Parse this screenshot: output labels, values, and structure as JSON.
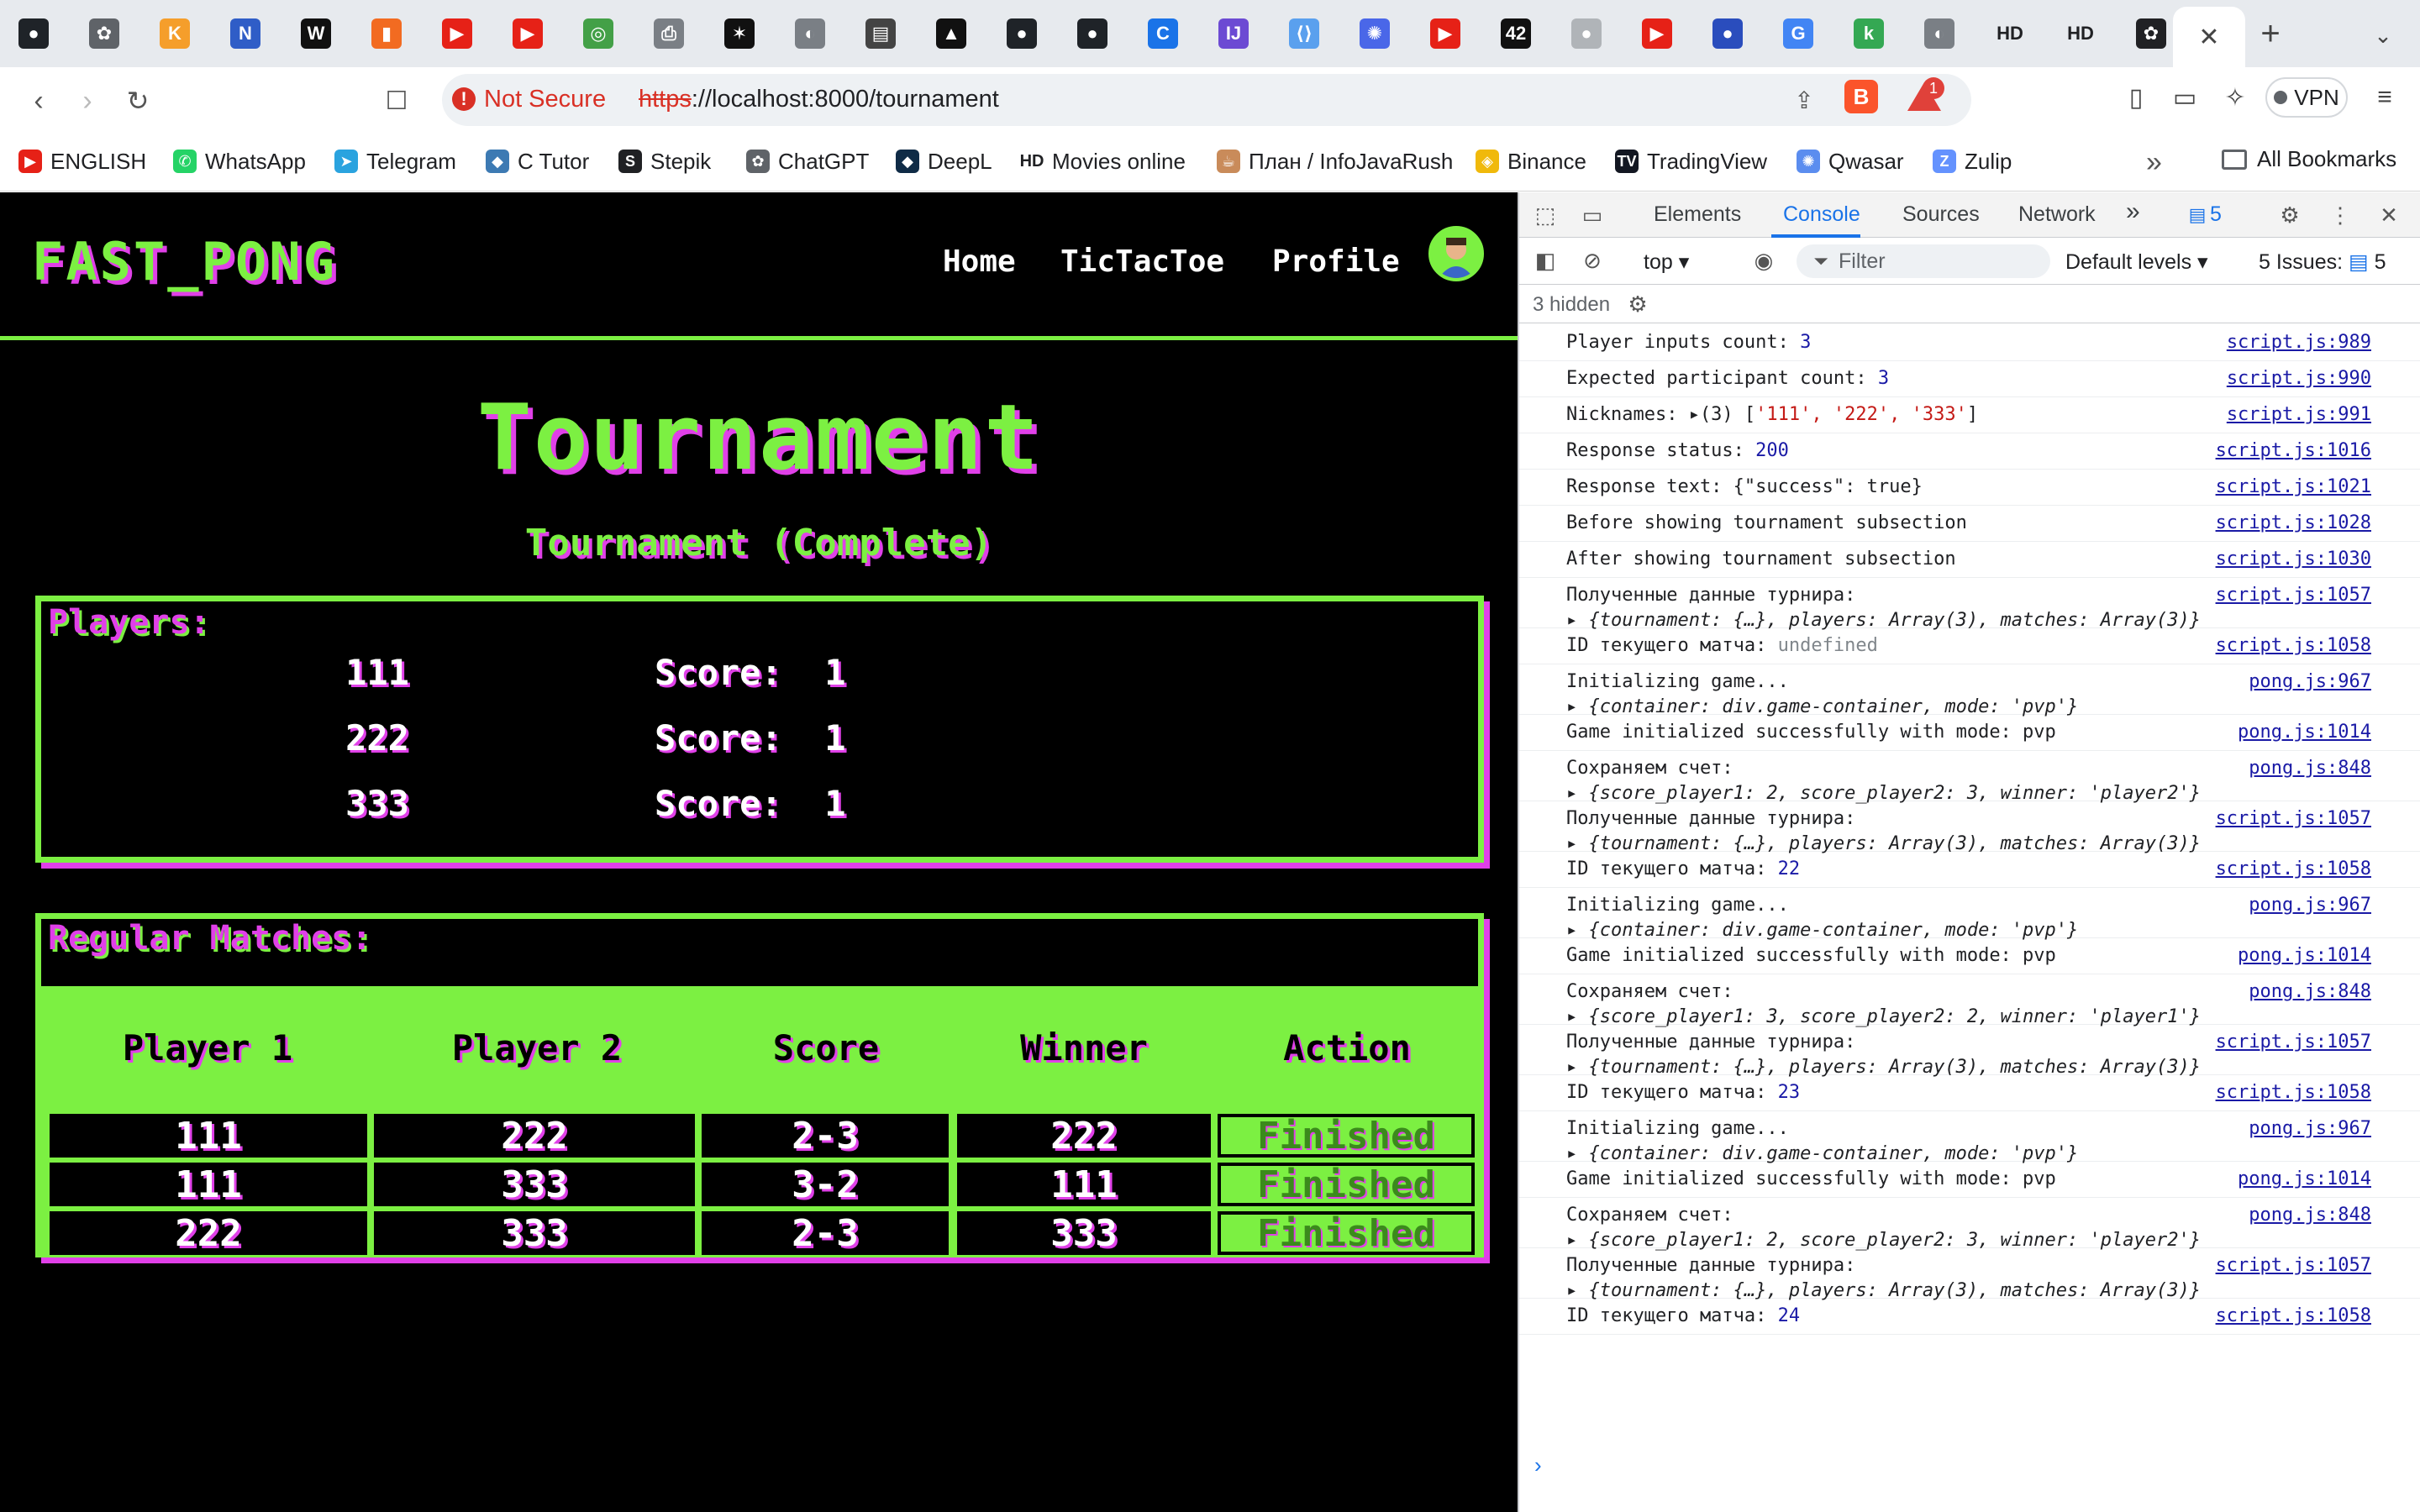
{
  "browser": {
    "tab_icons": [
      {
        "name": "github-icon",
        "glyph": "●",
        "bg": "#1f2328"
      },
      {
        "name": "openai-icon",
        "glyph": "✿",
        "bg": "#5f6368"
      },
      {
        "name": "k-icon",
        "glyph": "K",
        "bg": "#f59e2b"
      },
      {
        "name": "notion-icon",
        "glyph": "N",
        "bg": "#2f5dc7"
      },
      {
        "name": "www-icon",
        "glyph": "W",
        "bg": "#111"
      },
      {
        "name": "chart-icon",
        "glyph": "▮",
        "bg": "#f26b21"
      },
      {
        "name": "youtube-icon",
        "glyph": "▶",
        "bg": "#e62117"
      },
      {
        "name": "youtube-icon",
        "glyph": "▶",
        "bg": "#e62117"
      },
      {
        "name": "globe-green-icon",
        "glyph": "◎",
        "bg": "#43a047"
      },
      {
        "name": "printer-icon",
        "glyph": "⎙",
        "bg": "#7a7f85"
      },
      {
        "name": "app-icon",
        "glyph": "✶",
        "bg": "#111"
      },
      {
        "name": "globe-icon",
        "glyph": "◐",
        "bg": "#7a7f85"
      },
      {
        "name": "book-icon",
        "glyph": "▤",
        "bg": "#444"
      },
      {
        "name": "triangle-icon",
        "glyph": "▲",
        "bg": "#111"
      },
      {
        "name": "github-icon",
        "glyph": "●",
        "bg": "#1f2328"
      },
      {
        "name": "github-icon",
        "glyph": "●",
        "bg": "#1f2328"
      },
      {
        "name": "c-icon",
        "glyph": "C",
        "bg": "#1a73e8"
      },
      {
        "name": "jetbrains-icon",
        "glyph": "IJ",
        "bg": "#6c4ad3"
      },
      {
        "name": "code-icon",
        "glyph": "⟨⟩",
        "bg": "#5aa0ee"
      },
      {
        "name": "asterisk-icon",
        "glyph": "✺",
        "bg": "#4a67e8"
      },
      {
        "name": "youtube-icon",
        "glyph": "▶",
        "bg": "#e62117"
      },
      {
        "name": "42-icon",
        "glyph": "42",
        "bg": "#111"
      },
      {
        "name": "github-icon",
        "glyph": "●",
        "bg": "#b0b4b8"
      },
      {
        "name": "youtube-icon",
        "glyph": "▶",
        "bg": "#e62117"
      },
      {
        "name": "circle-blue-icon",
        "glyph": "●",
        "bg": "#2a4dbd"
      },
      {
        "name": "google-icon",
        "glyph": "G",
        "bg": "#4285f4"
      },
      {
        "name": "k-green-icon",
        "glyph": "k",
        "bg": "#34a853"
      },
      {
        "name": "globe-icon",
        "glyph": "◐",
        "bg": "#7a7f85"
      },
      {
        "name": "hd-icon",
        "glyph": "HD",
        "bg": "#e7eaee"
      },
      {
        "name": "hd-icon",
        "glyph": "HD",
        "bg": "#e7eaee"
      },
      {
        "name": "openai-icon",
        "glyph": "✿",
        "bg": "#202124"
      }
    ],
    "new_tab_glyph": "+",
    "close_tab_glyph": "✕",
    "tab_menu_glyph": "⌄",
    "not_secure": "Not Secure",
    "url_scheme": "https",
    "url_rest": "://localhost:8000/tournament",
    "vpn_label": "VPN",
    "alert_badge": "1",
    "bookmarks": [
      {
        "label": "ENGLISH",
        "icon": "youtube-icon",
        "glyph": "▶",
        "bg": "#e62117"
      },
      {
        "label": "WhatsApp",
        "icon": "whatsapp-icon",
        "glyph": "✆",
        "bg": "#25d366"
      },
      {
        "label": "Telegram",
        "icon": "telegram-icon",
        "glyph": "➤",
        "bg": "#2aa3df"
      },
      {
        "label": "C Tutor",
        "icon": "python-icon",
        "glyph": "◆",
        "bg": "#3d7ab3"
      },
      {
        "label": "Stepik",
        "icon": "stepik-icon",
        "glyph": "S",
        "bg": "#202124"
      },
      {
        "label": "ChatGPT",
        "icon": "openai-icon",
        "glyph": "✿",
        "bg": "#5f6368"
      },
      {
        "label": "DeepL",
        "icon": "deepl-icon",
        "glyph": "◆",
        "bg": "#0f2b46"
      },
      {
        "label": "Movies online",
        "icon": "hd-icon",
        "glyph": "HD",
        "bg": "#ffffff"
      },
      {
        "label": "План / InfoJavaRush",
        "icon": "coffee-icon",
        "glyph": "☕",
        "bg": "#c98b5a"
      },
      {
        "label": "Binance",
        "icon": "binance-icon",
        "glyph": "◈",
        "bg": "#f0b90b"
      },
      {
        "label": "TradingView",
        "icon": "tradingview-icon",
        "glyph": "TV",
        "bg": "#131722"
      },
      {
        "label": "Qwasar",
        "icon": "qwasar-icon",
        "glyph": "✺",
        "bg": "#5b8def"
      },
      {
        "label": "Zulip",
        "icon": "zulip-icon",
        "glyph": "Z",
        "bg": "#6492fe"
      }
    ],
    "more_bookmarks": "»",
    "all_bookmarks": "All Bookmarks"
  },
  "site": {
    "logo": "FAST_PONG",
    "nav": [
      "Home",
      "TicTacToe",
      "Profile"
    ],
    "title": "Tournament",
    "subtitle": "Tournament (Complete)",
    "players_label": "Players:",
    "players": [
      {
        "name": "111",
        "score_label": "Score:",
        "score": "1"
      },
      {
        "name": "222",
        "score_label": "Score:",
        "score": "1"
      },
      {
        "name": "333",
        "score_label": "Score:",
        "score": "1"
      }
    ],
    "matches_label": "Regular Matches:",
    "columns": [
      "Player 1",
      "Player 2",
      "Score",
      "Winner",
      "Action"
    ],
    "matches": [
      {
        "p1": "111",
        "p2": "222",
        "score": "2-3",
        "winner": "222",
        "action": "Finished"
      },
      {
        "p1": "111",
        "p2": "333",
        "score": "3-2",
        "winner": "111",
        "action": "Finished"
      },
      {
        "p1": "222",
        "p2": "333",
        "score": "2-3",
        "winner": "333",
        "action": "Finished"
      }
    ],
    "colors": {
      "accent": "#7cf042",
      "shadow": "#e040e8",
      "bg": "#000000"
    }
  },
  "devtools": {
    "tabs": [
      "Elements",
      "Console",
      "Sources",
      "Network"
    ],
    "active_tab": "Console",
    "more_tabs": "»",
    "issues_badge": "5",
    "context": "top ▾",
    "filter_placeholder": "Filter",
    "levels": "Default levels ▾",
    "issues_label": "5 Issues:",
    "issues_count": "5",
    "hidden": "3 hidden",
    "prompt": "›",
    "logs": [
      {
        "msg": "Player inputs count: ",
        "val": "3",
        "val_type": "num",
        "src": "script.js:989"
      },
      {
        "msg": "Expected participant count: ",
        "val": "3",
        "val_type": "num",
        "src": "script.js:990"
      },
      {
        "msg": "Nicknames: ▸(3) [",
        "val": "'111', '222', '333'",
        "val_type": "str",
        "tail": "]",
        "src": "script.js:991"
      },
      {
        "msg": "Response status: ",
        "val": "200",
        "val_type": "num",
        "src": "script.js:1016"
      },
      {
        "msg": "Response text: {\"success\": true}",
        "src": "script.js:1021"
      },
      {
        "msg": "Before showing tournament subsection",
        "src": "script.js:1028"
      },
      {
        "msg": "After showing tournament subsection",
        "src": "script.js:1030"
      },
      {
        "msg": "Полученные данные турнира:",
        "obj": "▸ {tournament: {…}, players: Array(3), matches: Array(3)}",
        "src": "script.js:1057"
      },
      {
        "msg": "ID текущего матча: ",
        "val": "undefined",
        "val_type": "undef",
        "src": "script.js:1058"
      },
      {
        "msg": "Initializing game...",
        "obj": "▸ {container: div.game-container, mode: 'pvp'}",
        "src": "pong.js:967"
      },
      {
        "msg": "Game initialized successfully with mode: pvp",
        "src": "pong.js:1014"
      },
      {
        "msg": "Сохраняем счет:",
        "obj": "▸ {score_player1: 2, score_player2: 3, winner: 'player2'}",
        "src": "pong.js:848"
      },
      {
        "msg": "Полученные данные турнира:",
        "obj": "▸ {tournament: {…}, players: Array(3), matches: Array(3)}",
        "src": "script.js:1057"
      },
      {
        "msg": "ID текущего матча: ",
        "val": "22",
        "val_type": "num",
        "src": "script.js:1058"
      },
      {
        "msg": "Initializing game...",
        "obj": "▸ {container: div.game-container, mode: 'pvp'}",
        "src": "pong.js:967"
      },
      {
        "msg": "Game initialized successfully with mode: pvp",
        "src": "pong.js:1014"
      },
      {
        "msg": "Сохраняем счет:",
        "obj": "▸ {score_player1: 3, score_player2: 2, winner: 'player1'}",
        "src": "pong.js:848"
      },
      {
        "msg": "Полученные данные турнира:",
        "obj": "▸ {tournament: {…}, players: Array(3), matches: Array(3)}",
        "src": "script.js:1057"
      },
      {
        "msg": "ID текущего матча: ",
        "val": "23",
        "val_type": "num",
        "src": "script.js:1058"
      },
      {
        "msg": "Initializing game...",
        "obj": "▸ {container: div.game-container, mode: 'pvp'}",
        "src": "pong.js:967"
      },
      {
        "msg": "Game initialized successfully with mode: pvp",
        "src": "pong.js:1014"
      },
      {
        "msg": "Сохраняем счет:",
        "obj": "▸ {score_player1: 2, score_player2: 3, winner: 'player2'}",
        "src": "pong.js:848"
      },
      {
        "msg": "Полученные данные турнира:",
        "obj": "▸ {tournament: {…}, players: Array(3), matches: Array(3)}",
        "src": "script.js:1057"
      },
      {
        "msg": "ID текущего матча: ",
        "val": "24",
        "val_type": "num",
        "src": "script.js:1058"
      }
    ]
  }
}
